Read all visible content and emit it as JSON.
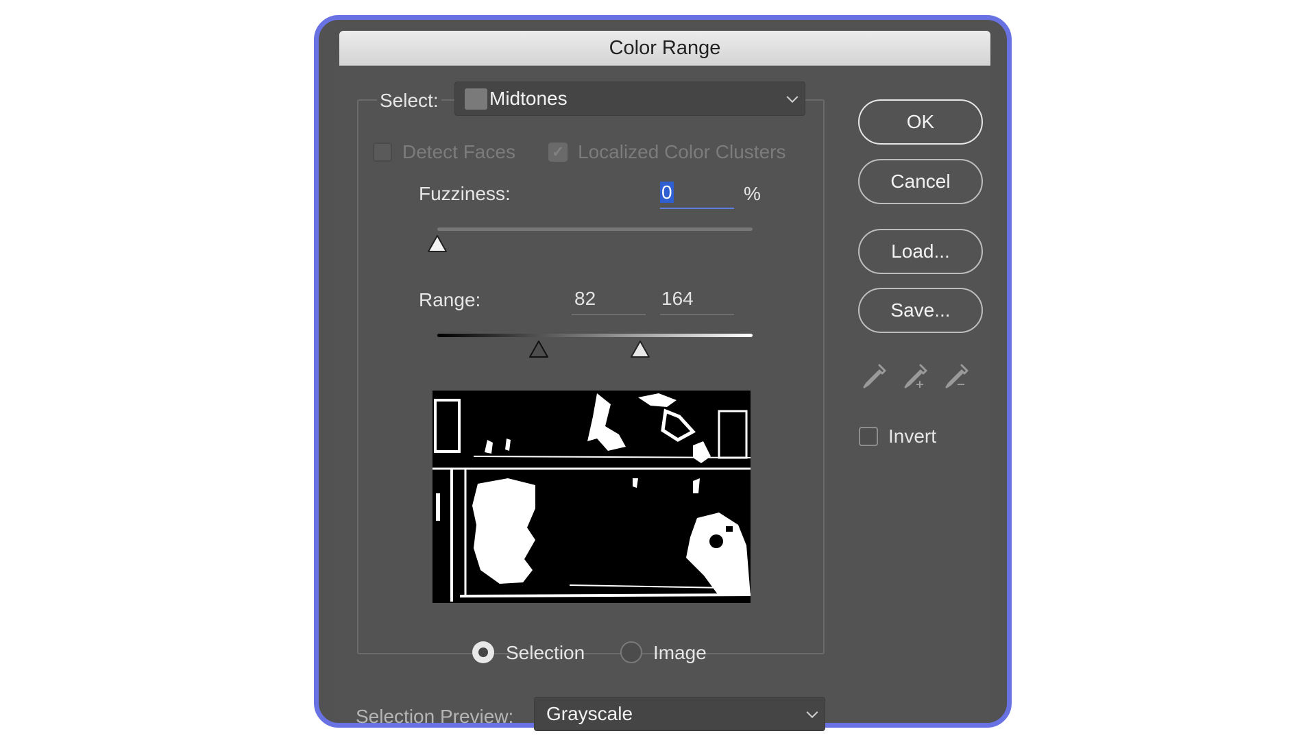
{
  "dialog": {
    "title": "Color Range"
  },
  "select": {
    "label": "Select:",
    "value": "Midtones"
  },
  "options": {
    "detect_faces": {
      "label": "Detect Faces",
      "checked": false,
      "enabled": false
    },
    "localized_clusters": {
      "label": "Localized Color Clusters",
      "checked": true,
      "enabled": false
    }
  },
  "fuzziness": {
    "label": "Fuzziness:",
    "value": "0",
    "unit": "%",
    "slider_fraction": 0
  },
  "range": {
    "label": "Range:",
    "low": "82",
    "high": "164",
    "low_value": 82,
    "high_value": 164,
    "max": 255
  },
  "view": {
    "selection_label": "Selection",
    "image_label": "Image",
    "selected": "selection"
  },
  "preview": {
    "label": "Selection Preview:",
    "value": "Grayscale"
  },
  "buttons": {
    "ok": "OK",
    "cancel": "Cancel",
    "load": "Load...",
    "save": "Save..."
  },
  "tools": {
    "icons": [
      "eyedropper-icon",
      "eyedropper-plus-icon",
      "eyedropper-minus-icon"
    ]
  },
  "invert": {
    "label": "Invert",
    "checked": false
  },
  "colors": {
    "focus": "#5d7fe4",
    "frame": "#6872e2"
  }
}
